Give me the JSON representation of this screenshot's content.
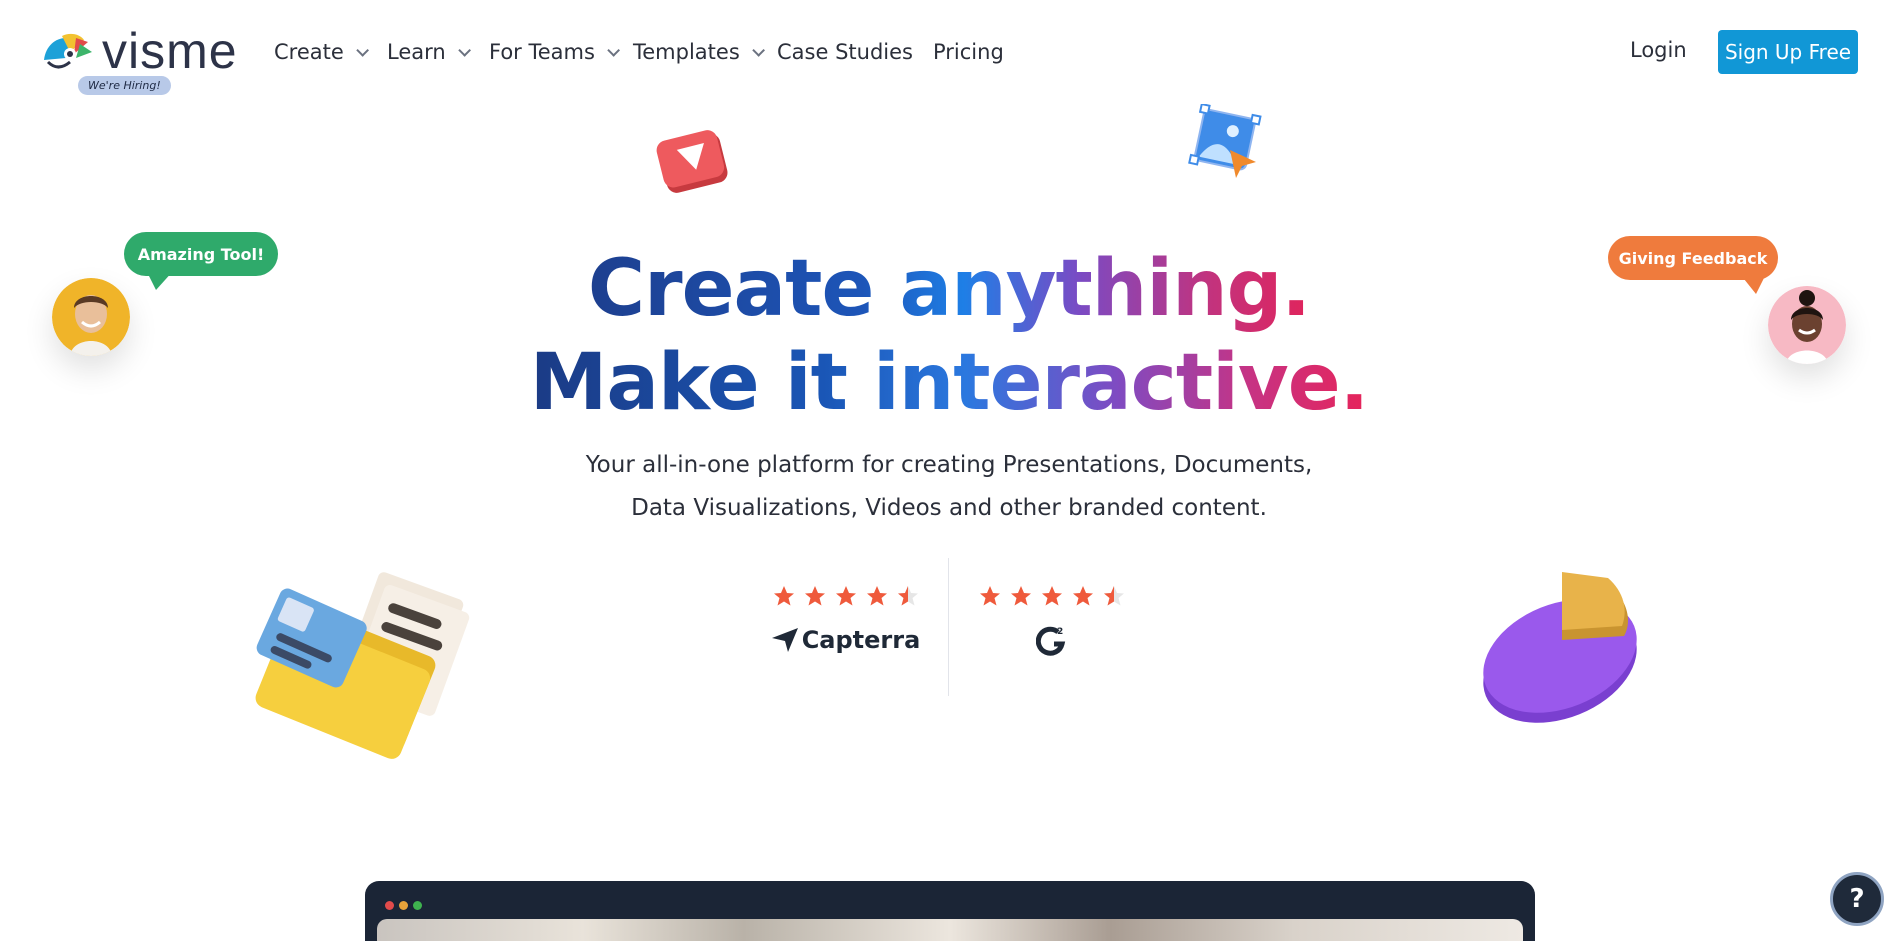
{
  "brand": {
    "logo_text": "visme",
    "hiring_badge": "We're Hiring!"
  },
  "nav": {
    "items": [
      {
        "label": "Create",
        "has_dropdown": true
      },
      {
        "label": "Learn",
        "has_dropdown": true
      },
      {
        "label": "For Teams",
        "has_dropdown": true
      },
      {
        "label": "Templates",
        "has_dropdown": true
      },
      {
        "label": "Case Studies",
        "has_dropdown": false
      },
      {
        "label": "Pricing",
        "has_dropdown": false
      }
    ],
    "login_label": "Login",
    "signup_label": "Sign Up Free"
  },
  "hero": {
    "headline_line1": "Create anything.",
    "headline_line2": "Make it interactive.",
    "subtitle_line1": "Your all-in-one platform for creating Presentations, Documents,",
    "subtitle_line2": "Data Visualizations, Videos and other branded content."
  },
  "ratings": [
    {
      "source": "Capterra",
      "stars": 4.5
    },
    {
      "source": "G2",
      "stars": 4.5
    }
  ],
  "bubbles": {
    "left": "Amazing Tool!",
    "right": "Giving Feedback"
  },
  "help_button": "?",
  "colors": {
    "accent": "#1197d6",
    "star": "#ef5a3c",
    "bubble_left": "#2faa6b",
    "bubble_right": "#ef7b3d",
    "preview_frame": "#1b2536"
  },
  "icons": {
    "play": "play-icon",
    "image": "image-cursor-icon",
    "folder": "folder-documents-icon",
    "pie": "pie-chart-icon",
    "help": "help-icon"
  }
}
